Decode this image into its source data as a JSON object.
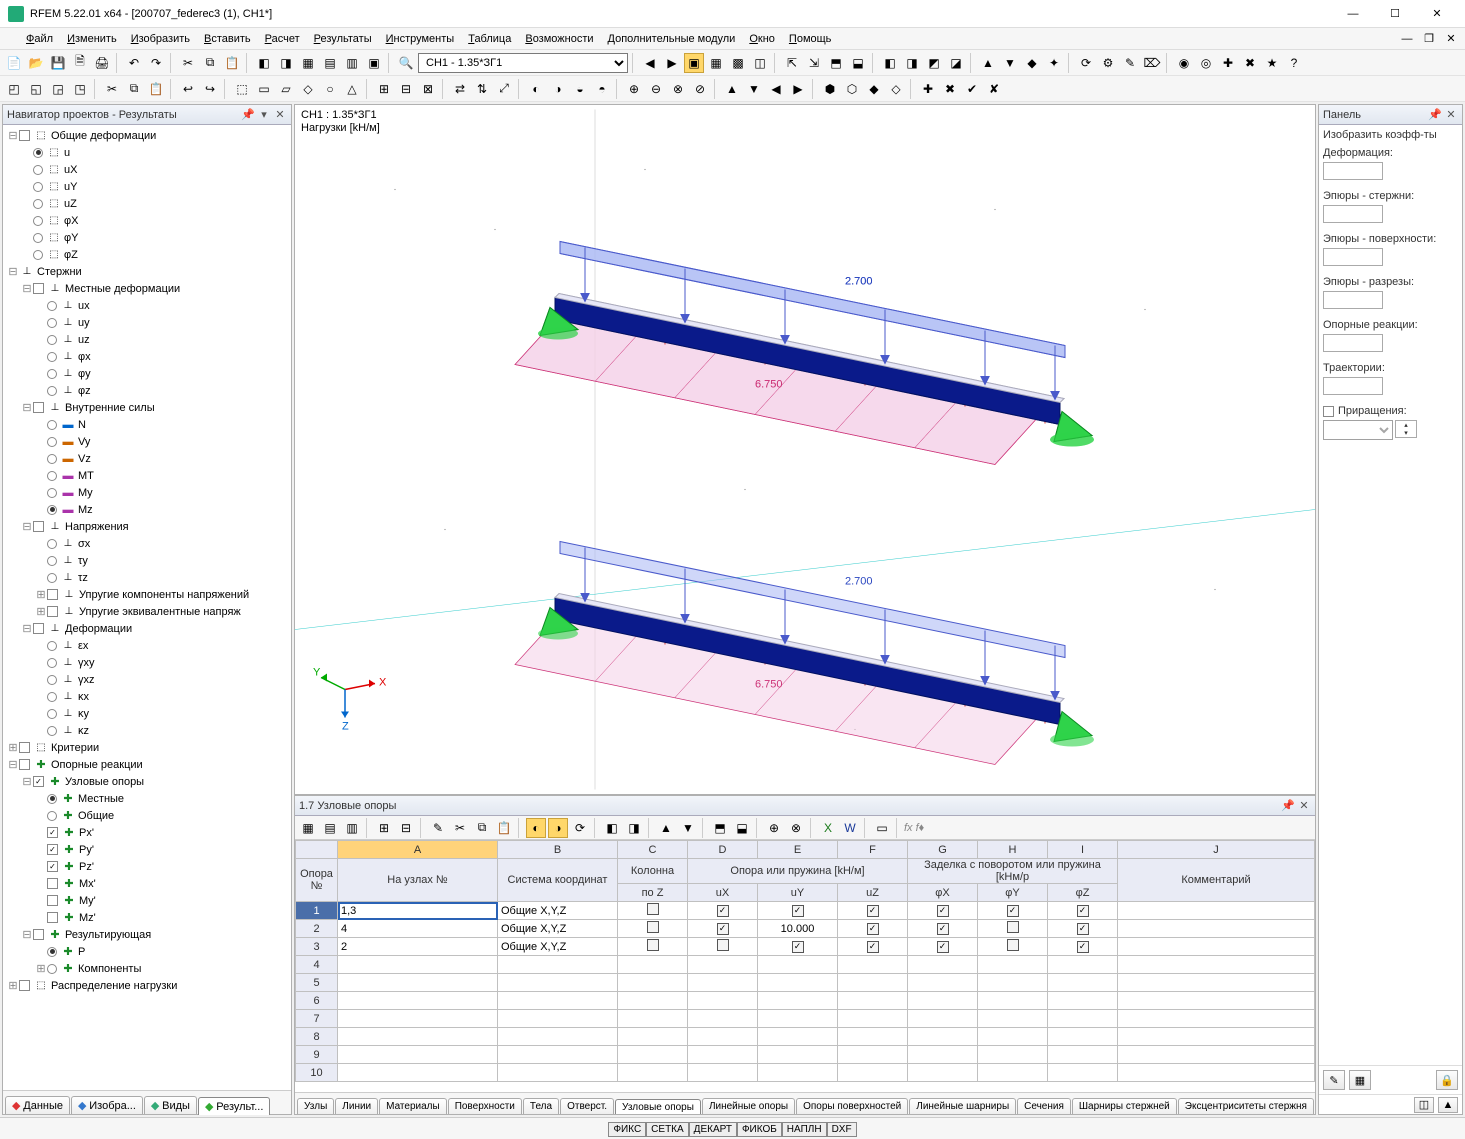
{
  "window": {
    "title": "RFEM 5.22.01 x64 - [200707_federec3 (1), CH1*]"
  },
  "menu": [
    "Файл",
    "Изменить",
    "Изобразить",
    "Вставить",
    "Расчет",
    "Результаты",
    "Инструменты",
    "Таблица",
    "Возможности",
    "Дополнительные модули",
    "Окно",
    "Помощь"
  ],
  "loadcase_combo": "CH1 - 1.35*ЗГ1",
  "navigator": {
    "title": "Навигатор проектов - Результаты",
    "tabs": [
      "Данные",
      "Изобра...",
      "Виды",
      "Результ..."
    ],
    "tree": {
      "obshie_deform": "Общие деформации",
      "u": "u",
      "ux": "uX",
      "uy": "uY",
      "uz": "uZ",
      "phix": "φX",
      "phiy": "φY",
      "phiz": "φZ",
      "sterzhni": "Стержни",
      "mest_deform": "Местные деформации",
      "ux2": "ux",
      "uy2": "uy",
      "uz2": "uz",
      "phix2": "φx",
      "phiy2": "φy",
      "phiz2": "φz",
      "vnutr": "Внутренние силы",
      "N": "N",
      "Vy": "Vy",
      "Vz": "Vz",
      "Mt": "MT",
      "My": "My",
      "Mz": "Mz",
      "napr": "Напряжения",
      "sx": "σx",
      "ty": "τy",
      "tz": "τz",
      "upr_komp": "Упругие компоненты напряжений",
      "upr_ekv": "Упругие эквивалентные напряж",
      "deform": "Деформации",
      "ex": "εx",
      "gxy": "γxy",
      "gxz": "γxz",
      "kx": "κx",
      "ky": "κy",
      "kz": "κz",
      "kriterii": "Критерии",
      "opor": "Опорные реакции",
      "uzl": "Узловые опоры",
      "mestnye": "Местные",
      "obshie": "Общие",
      "Px": "Px'",
      "Py": "Py'",
      "Pz": "Pz'",
      "Mx": "Mx'",
      "My2": "My'",
      "Mz2": "Mz'",
      "rez": "Результирующая",
      "P": "P",
      "komp": "Компоненты",
      "raspr": "Распределение нагрузки"
    }
  },
  "viewport": {
    "line1": "CH1 : 1.35*ЗГ1",
    "line2": "Нагрузки [kН/м]",
    "load": "2.700",
    "dim": "6.750"
  },
  "table": {
    "title": "1.7 Узловые опоры",
    "formula_hint": "fx f♦",
    "cols_letters": [
      "A",
      "B",
      "C",
      "D",
      "E",
      "F",
      "G",
      "H",
      "I",
      "J"
    ],
    "grp1": "Опора",
    "grp_num": "№",
    "grp_nodes": "На узлах №",
    "grp_coord": "Система координат",
    "grp_col": "Колонна",
    "grp_colz": "по Z",
    "grp_sup": "Опора или пружина [kН/м]",
    "ux": "uX",
    "uy": "uY",
    "uz": "uZ",
    "grp_rot": "Заделка с поворотом или пружина [kНм/р",
    "phx": "φX",
    "phy": "φY",
    "phz": "φZ",
    "grp_comm": "Комментарий",
    "rows": [
      {
        "n": "1",
        "nodes": "1,3",
        "coord": "Общие X,Y,Z",
        "col": false,
        "ux": true,
        "uy": true,
        "uz": true,
        "phx": true,
        "phy": true,
        "phz": true
      },
      {
        "n": "2",
        "nodes": "4",
        "coord": "Общие X,Y,Z",
        "col": false,
        "ux": true,
        "uy": "10.000",
        "uz": true,
        "phx": true,
        "phy": false,
        "phz": true
      },
      {
        "n": "3",
        "nodes": "2",
        "coord": "Общие X,Y,Z",
        "col": false,
        "ux": false,
        "uy": true,
        "uz": true,
        "phx": true,
        "phy": false,
        "phz": true
      }
    ],
    "tabs": [
      "Узлы",
      "Линии",
      "Материалы",
      "Поверхности",
      "Тела",
      "Отверст.",
      "Узловые опоры",
      "Линейные опоры",
      "Опоры поверхностей",
      "Линейные шарниры",
      "Сечения",
      "Шарниры стержней",
      "Эксцентриситеты стержня"
    ]
  },
  "rightpanel": {
    "title": "Панель",
    "head": "Изобразить коэфф-ты",
    "secs": [
      "Деформация:",
      "Эпюры - стержни:",
      "Эпюры - поверхности:",
      "Эпюры - разрезы:",
      "Опорные реакции:",
      "Траектории:"
    ],
    "incr": "Приращения:"
  },
  "statusbar": [
    "ФИКС",
    "СЕТКА",
    "ДЕКАРТ",
    "ФИКОБ",
    "НАПЛН",
    "DXF"
  ]
}
